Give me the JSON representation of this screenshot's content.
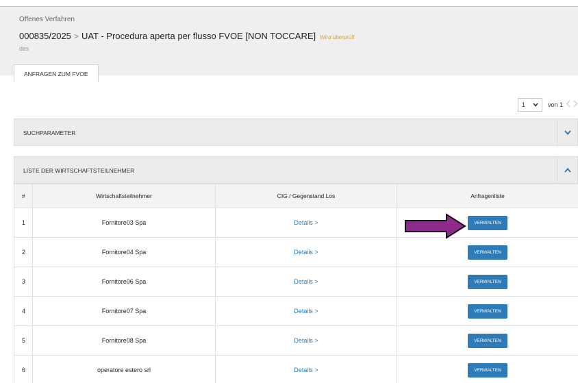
{
  "header": {
    "kicker": "Offenes Verfahren",
    "id": "000835/2025",
    "separator": ">",
    "title": "UAT - Procedura aperta per flusso FVOE [NON TOCCARE]",
    "status": "Wird überprüft",
    "subtitle": "des"
  },
  "tabs": [
    {
      "label": "ANFRAGEN ZUM FVOE",
      "active": true
    }
  ],
  "pager": {
    "current": "1",
    "of_label": "von 1"
  },
  "panels": {
    "search": {
      "label": "SUCHPARAMETER",
      "expanded": false
    },
    "list": {
      "label": "LISTE DER WIRTSCHAFTSTEILNEHMER",
      "expanded": true
    }
  },
  "table": {
    "headers": [
      "#",
      "Wirtschaftsteilnehmer",
      "CIG / Gegenstand Los",
      "Anfragenliste"
    ],
    "rows": [
      {
        "num": "1",
        "operator": "Fornitore03 Spa",
        "details": "Details >",
        "action": "VERWALTEN"
      },
      {
        "num": "2",
        "operator": "Fornitore04 Spa",
        "details": "Details >",
        "action": "VERWALTEN"
      },
      {
        "num": "3",
        "operator": "Fornitore06 Spa",
        "details": "Details >",
        "action": "VERWALTEN"
      },
      {
        "num": "4",
        "operator": "Fornitore07 Spa",
        "details": "Details >",
        "action": "VERWALTEN"
      },
      {
        "num": "5",
        "operator": "Fornitore08 Spa",
        "details": "Details >",
        "action": "VERWALTEN"
      },
      {
        "num": "6",
        "operator": "operatore estero srl",
        "details": "Details >",
        "action": "VERWALTEN"
      }
    ]
  },
  "colors": {
    "accent_blue": "#2e7bb8",
    "link_blue": "#2a7ab8",
    "status_gold": "#d4a23a",
    "annotation_purple": "#8e2a8e"
  },
  "icons": {
    "pager_select": "chevron-down-icon",
    "pager_prev": "chevron-left-icon",
    "pager_next": "chevron-right-icon",
    "search_toggle": "chevron-down-icon",
    "list_toggle": "chevron-up-icon",
    "annotation": "arrow-right-icon"
  }
}
